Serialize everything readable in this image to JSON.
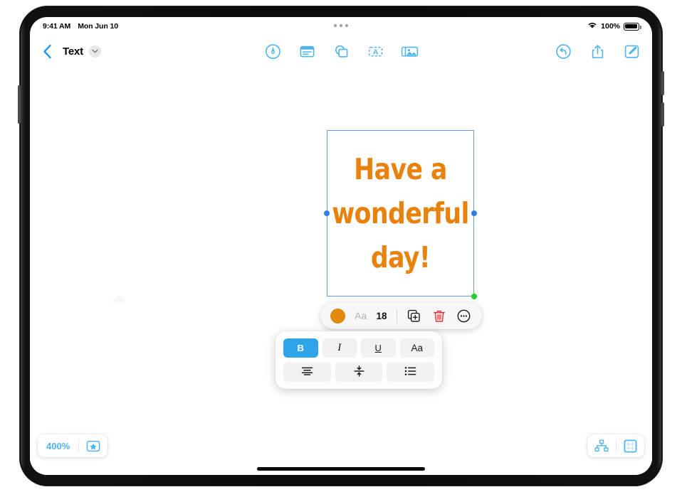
{
  "status_bar": {
    "time": "9:41 AM",
    "date": "Mon Jun 10",
    "battery_percent": "100%",
    "wifi_icon": "wifi-icon",
    "battery_icon": "battery-icon",
    "multitask_handle": "multitasking-handle"
  },
  "nav_bar": {
    "back_icon": "back-chevron-icon",
    "document_title": "Text",
    "title_caret_icon": "chevron-down-icon",
    "center_tools": [
      {
        "name": "markup-pen-tool",
        "label": "Markup"
      },
      {
        "name": "format-document-tool",
        "label": "Format"
      },
      {
        "name": "shapes-tool",
        "label": "Shapes"
      },
      {
        "name": "text-box-tool",
        "label": "Text Box"
      },
      {
        "name": "media-tool",
        "label": "Media"
      }
    ],
    "right_tools": [
      {
        "name": "undo-button",
        "label": "Undo"
      },
      {
        "name": "share-button",
        "label": "Share"
      },
      {
        "name": "compose-button",
        "label": "Compose"
      }
    ]
  },
  "canvas": {
    "text_object": {
      "lines": [
        "Have a",
        "wonderful",
        "day!"
      ],
      "text_color": "#e8820c",
      "selection_color": "#6b9aea",
      "handle_color": "#2f7fe4",
      "resize_handle_color": "#1fd321"
    },
    "edge_marker": "2"
  },
  "context_toolbar": {
    "color_swatch": {
      "name": "text-color-swatch",
      "color": "#e0890b"
    },
    "font_label": "Aa",
    "font_size": "18",
    "duplicate_icon": "duplicate-icon",
    "delete_icon": "trash-icon",
    "more_icon": "more-options-icon",
    "delete_color": "#e83030"
  },
  "format_popover": {
    "row1": [
      {
        "name": "bold-button",
        "label": "B",
        "active": true
      },
      {
        "name": "italic-button",
        "label": "I",
        "active": false
      },
      {
        "name": "underline-button",
        "label": "U",
        "active": false
      },
      {
        "name": "font-style-button",
        "label": "Aa",
        "active": false
      }
    ],
    "row2": [
      {
        "name": "text-align-button",
        "icon": "align-center-icon"
      },
      {
        "name": "line-spacing-button",
        "icon": "line-spacing-icon"
      },
      {
        "name": "bullet-list-button",
        "icon": "bullet-list-icon"
      }
    ],
    "active_color": "#2fa4e7"
  },
  "bottom_bar": {
    "zoom_level": "400%",
    "favorite_icon": "star-box-icon",
    "hierarchy_icon": "hierarchy-icon",
    "canvas_view_icon": "canvas-grid-icon"
  }
}
